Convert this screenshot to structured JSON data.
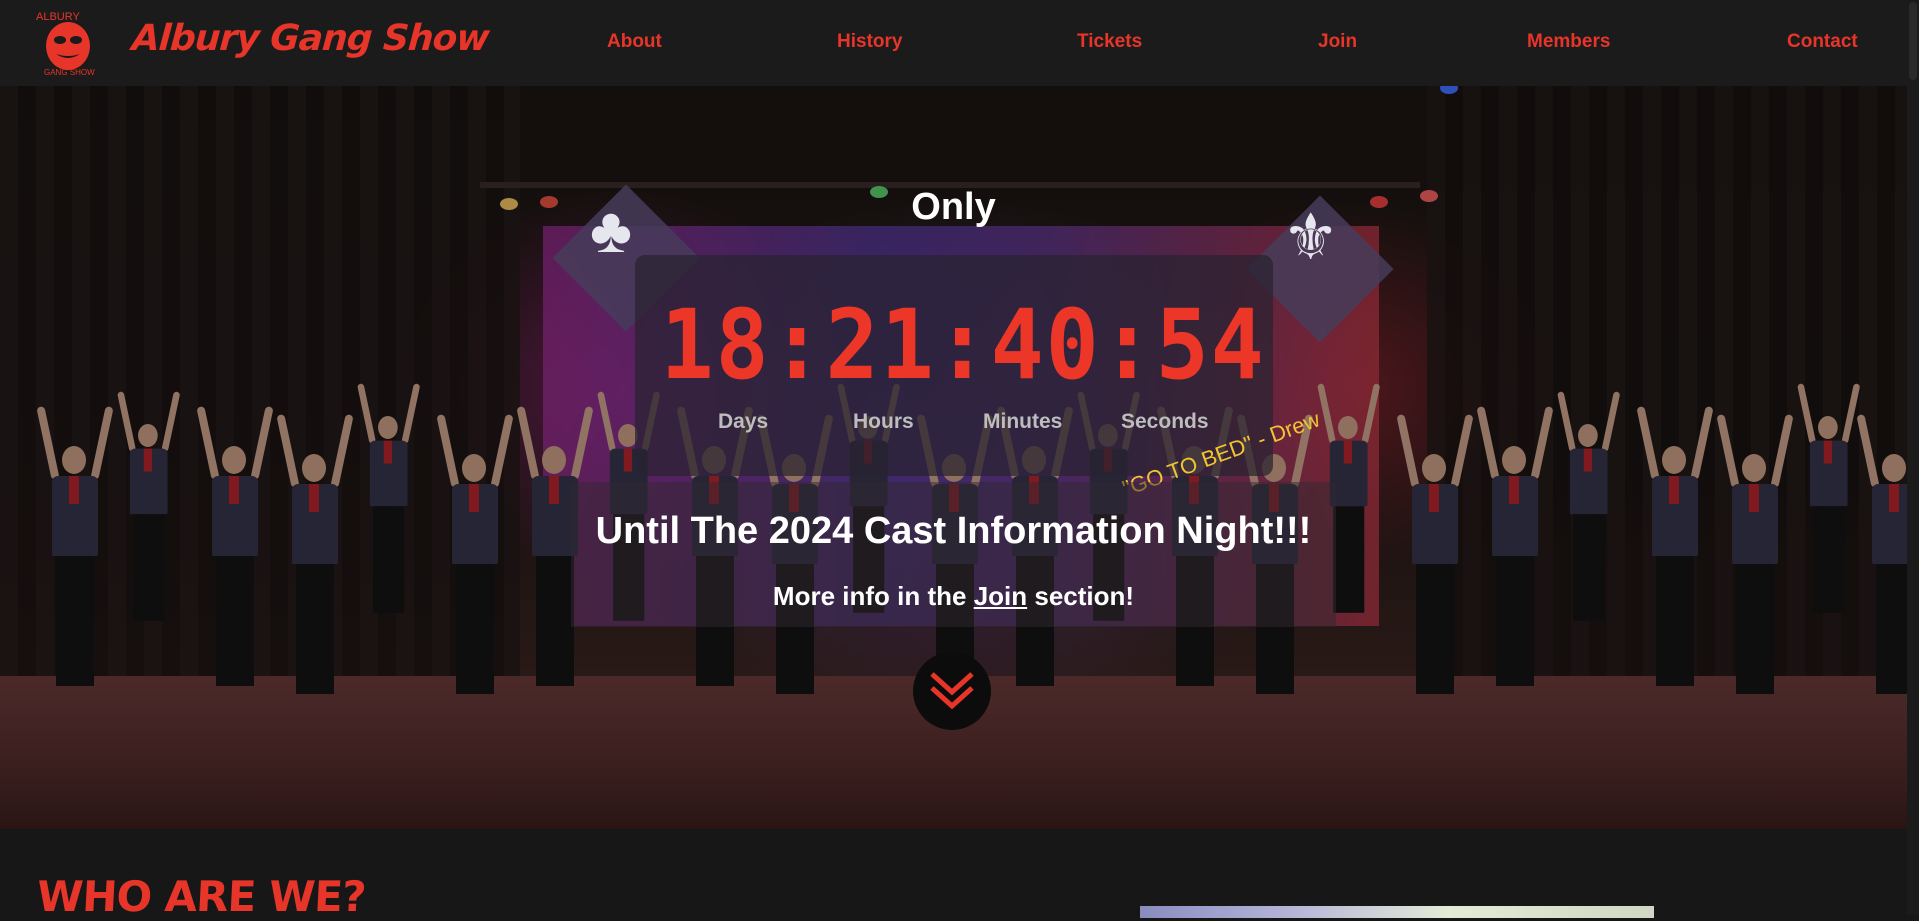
{
  "header": {
    "brand": "Albury Gang Show",
    "logo_text_top": "ALBURY",
    "logo_text_bottom": "GANG SHOW",
    "nav": [
      "About",
      "History",
      "Tickets",
      "Join",
      "Members",
      "Contact"
    ]
  },
  "hero": {
    "only_label": "Only",
    "countdown": {
      "display": "18:21:40:54",
      "days": "18",
      "hours": "21",
      "minutes": "40",
      "seconds": "54",
      "units": [
        "Days",
        "Hours",
        "Minutes",
        "Seconds"
      ]
    },
    "quote": "\"GO TO BED\" - Drew",
    "headline": "Until The 2024 Cast Information Night!!!",
    "more_info_prefix": "More info in the ",
    "more_info_link": "Join",
    "more_info_suffix": " section!"
  },
  "section": {
    "heading": "WHO ARE WE?"
  },
  "colors": {
    "accent": "#e8352a",
    "header_bg": "#1c1b1b",
    "page_bg": "#171717",
    "quote": "#f2c431"
  },
  "icons": {
    "logo": "theatre-mask-logo",
    "scroll": "double-chevron-down-icon",
    "emblem_left": "trefoil-emblem",
    "emblem_right": "fleur-de-lis-emblem"
  }
}
